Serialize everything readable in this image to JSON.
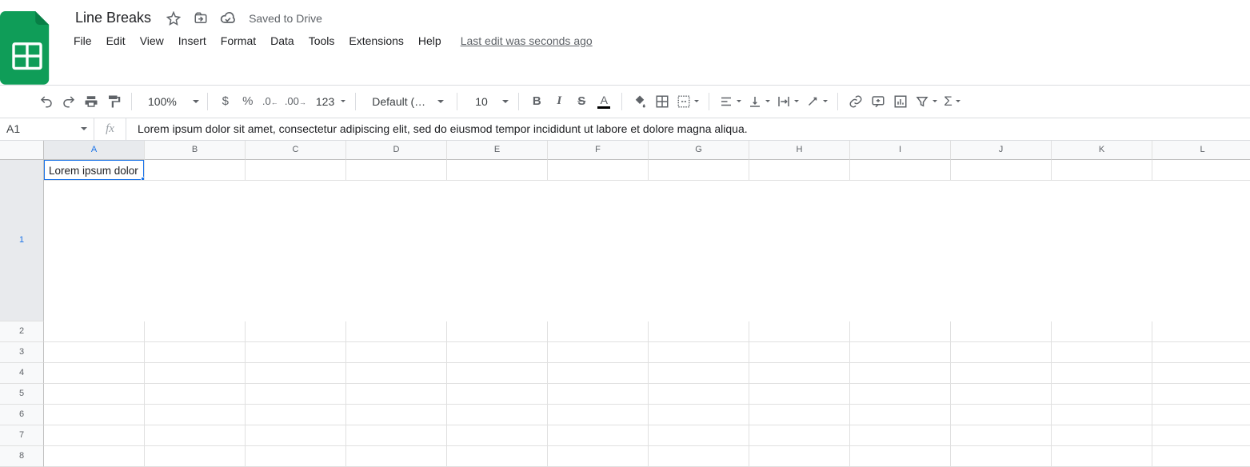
{
  "doc": {
    "title": "Line Breaks",
    "saved_status": "Saved to Drive"
  },
  "menu": {
    "file": "File",
    "edit": "Edit",
    "view": "View",
    "insert": "Insert",
    "format": "Format",
    "data": "Data",
    "tools": "Tools",
    "extensions": "Extensions",
    "help": "Help",
    "last_edit": "Last edit was seconds ago"
  },
  "toolbar": {
    "zoom": "100%",
    "number_format": "123",
    "font": "Default (Ari...",
    "font_size": "10"
  },
  "namebox": {
    "active_cell": "A1",
    "fx_label": "fx",
    "formula": "Lorem ipsum dolor sit amet, consectetur adipiscing elit, sed do eiusmod tempor incididunt ut labore et dolore magna aliqua."
  },
  "grid": {
    "columns": [
      "A",
      "B",
      "C",
      "D",
      "E",
      "F",
      "G",
      "H",
      "I",
      "J",
      "K",
      "L"
    ],
    "rows": [
      "1",
      "2",
      "3",
      "4",
      "5",
      "6",
      "7",
      "8"
    ],
    "cells": {
      "A1": "Lorem ipsum dolor sit amet, consectetur adipiscing elit, sed do eiusmod tempor incididunt ut labore et dolore magna aliqua."
    }
  }
}
